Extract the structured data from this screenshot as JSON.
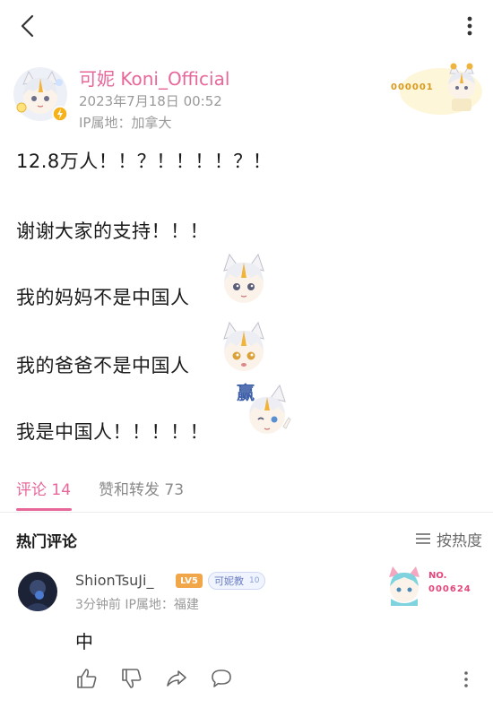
{
  "author": {
    "name": "可妮 Koni_Official",
    "time": "2023年7月18日 00:52",
    "ip": "IP属地：加拿大",
    "badge_number": "000001"
  },
  "post": {
    "lines": [
      "12.8万人！！？！！！！？！",
      "谢谢大家的支持！！！",
      "我的妈妈不是中国人",
      "我的爸爸不是中国人",
      "我是中国人！！！！！"
    ],
    "sticker_text": "赢"
  },
  "tabs": {
    "comments": "评论 14",
    "likes_reposts": "赞和转发 73"
  },
  "hot": {
    "title": "热门评论",
    "sort_label": "按热度"
  },
  "comment": {
    "user": "ShionTsuJi_",
    "level": "LV5",
    "fan_badge": "可妮教",
    "fan_level": "10",
    "meta": "3分钟前  IP属地：福建",
    "text": "中",
    "badge_no": "NO.",
    "badge_number": "000624"
  },
  "colors": {
    "accent_pink": "#e8679a",
    "level_orange": "#f1a64a",
    "gold": "#d79a1e"
  },
  "icons": [
    "back-arrow-icon",
    "more-vertical-icon",
    "sort-lines-icon",
    "thumbs-up-icon",
    "thumbs-down-icon",
    "share-icon",
    "comment-bubble-icon"
  ]
}
